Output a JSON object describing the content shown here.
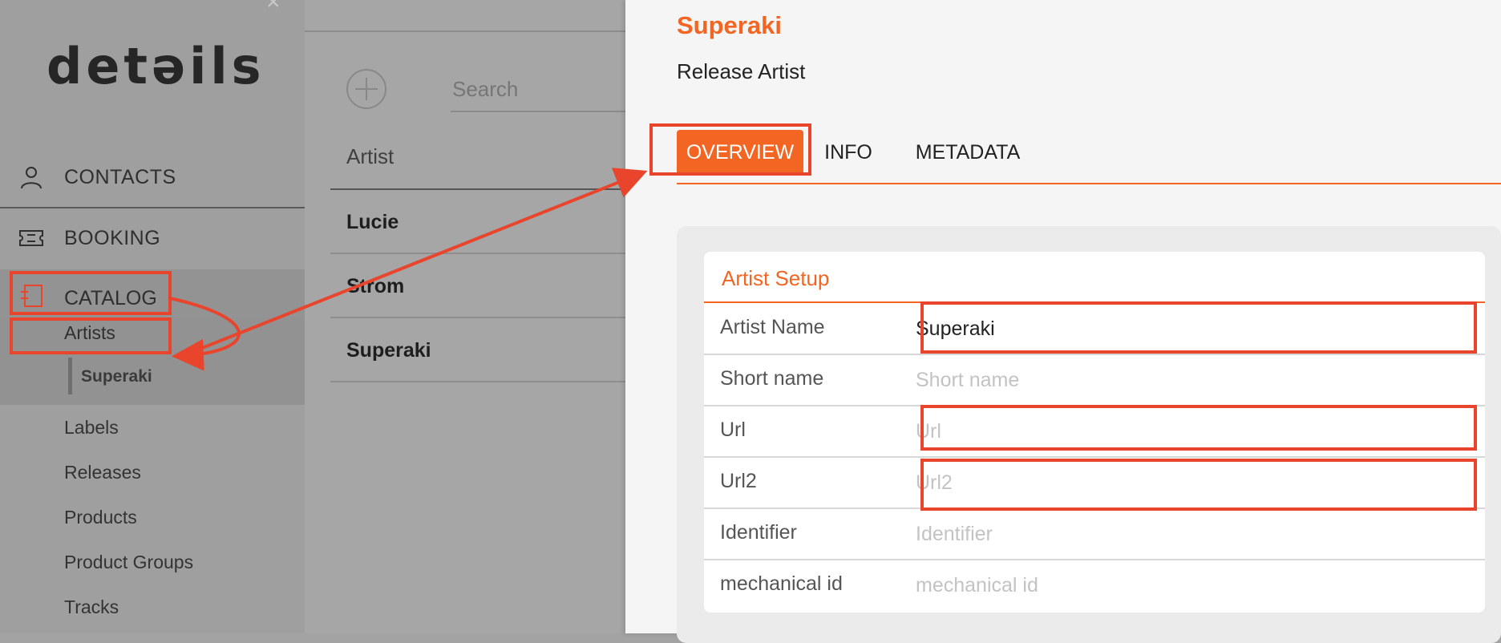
{
  "sidebar": {
    "logo": "detəils",
    "nav": {
      "contacts": "CONTACTS",
      "booking": "BOOKING",
      "catalog": "CATALOG"
    },
    "catalog_sub": {
      "artists": "Artists",
      "selected_artist": "Superaki",
      "items": [
        "Labels",
        "Releases",
        "Products",
        "Product Groups",
        "Tracks"
      ]
    }
  },
  "list": {
    "search_placeholder": "Search",
    "column_header": "Artist",
    "rows": [
      "Lucie",
      "Strom",
      "Superaki"
    ]
  },
  "panel": {
    "title": "Superaki",
    "subtitle": "Release Artist",
    "tabs": [
      "OVERVIEW",
      "INFO",
      "METADATA"
    ],
    "section_title": "Artist Setup",
    "fields": [
      {
        "label": "Artist Name",
        "value": "Superaki",
        "placeholder": ""
      },
      {
        "label": "Short name",
        "value": "",
        "placeholder": "Short name"
      },
      {
        "label": "Url",
        "value": "",
        "placeholder": "Url"
      },
      {
        "label": "Url2",
        "value": "",
        "placeholder": "Url2"
      },
      {
        "label": "Identifier",
        "value": "",
        "placeholder": "Identifier"
      },
      {
        "label": "mechanical id",
        "value": "",
        "placeholder": "mechanical id"
      }
    ]
  },
  "colors": {
    "accent": "#f26522",
    "annotation": "#e8452c"
  },
  "icons": {
    "contacts": "person-icon",
    "booking": "ticket-icon",
    "catalog": "catalog-icon"
  }
}
